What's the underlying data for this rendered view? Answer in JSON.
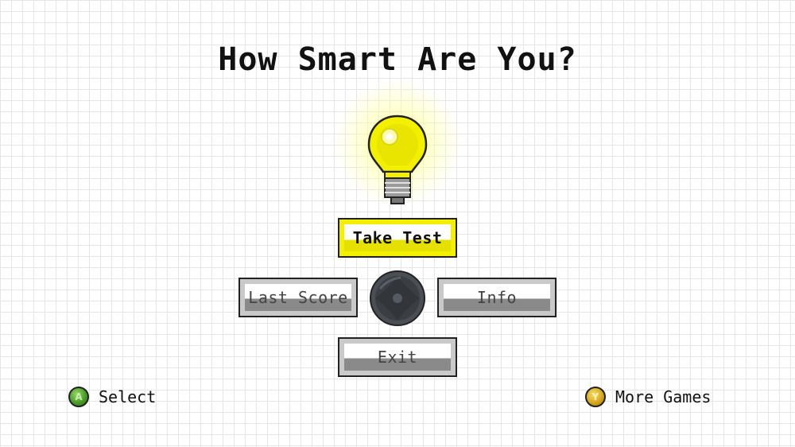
{
  "title": "How Smart Are You?",
  "colors": {
    "bulb": "#f2ef00",
    "selected_button": "#f2ef00",
    "button": "#c9c9c9",
    "a_button": "#4a9c2a",
    "y_button": "#d8a81e"
  },
  "icons": {
    "bulb": "lightbulb-icon",
    "dpad": "dpad-icon",
    "a_button": "a-button-icon",
    "y_button": "y-button-icon"
  },
  "menu": {
    "take_test": "Take Test",
    "last_score": "Last Score",
    "info": "Info",
    "exit": "Exit",
    "selected": "Take Test"
  },
  "footer": {
    "select_glyph": "A",
    "select_label": "Select",
    "more_glyph": "Y",
    "more_label": "More Games"
  }
}
